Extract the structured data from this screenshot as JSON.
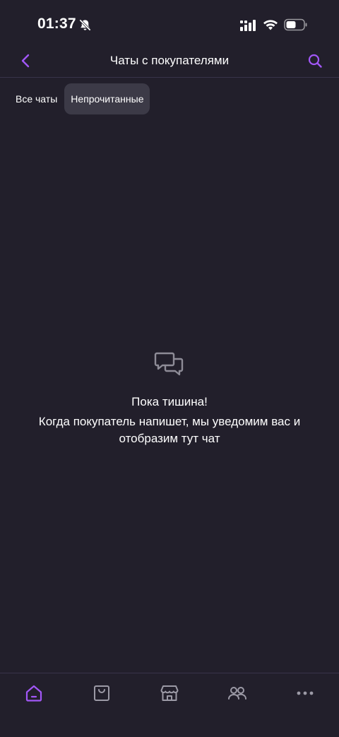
{
  "status_bar": {
    "time": "01:37",
    "icons": [
      "bell-slash-icon",
      "signal-icon",
      "wifi-icon",
      "battery-icon"
    ]
  },
  "header": {
    "title": "Чаты с покупателями",
    "back_icon": "chevron-left-icon",
    "search_icon": "search-icon"
  },
  "filters": {
    "tabs": [
      {
        "label": "Все чаты",
        "active": false
      },
      {
        "label": "Непрочитанные",
        "active": true
      }
    ]
  },
  "empty_state": {
    "icon": "chat-bubbles-icon",
    "title": "Пока тишина!",
    "text": "Когда покупатель напишет, мы уведомим вас и отобразим тут чат"
  },
  "bottom_nav": {
    "items": [
      {
        "icon": "home-icon",
        "active": true
      },
      {
        "icon": "shopping-bag-icon",
        "active": false
      },
      {
        "icon": "store-icon",
        "active": false
      },
      {
        "icon": "users-icon",
        "active": false
      },
      {
        "icon": "more-icon",
        "active": false
      }
    ]
  },
  "colors": {
    "background": "#221f2b",
    "accent": "#a257f7",
    "tab_active_bg": "#3c3a47",
    "icon_inactive": "#9c9aa6",
    "divider": "#38344a"
  }
}
